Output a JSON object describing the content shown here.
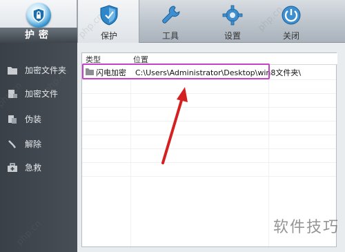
{
  "app": {
    "logo_label": "护密"
  },
  "toolbar": {
    "items": [
      {
        "label": "保护",
        "icon": "shield-icon",
        "active": true
      },
      {
        "label": "工具",
        "icon": "wrench-icon",
        "active": false
      },
      {
        "label": "设置",
        "icon": "gear-icon",
        "active": false
      },
      {
        "label": "关闭",
        "icon": "power-icon",
        "active": false
      }
    ]
  },
  "sidebar": {
    "items": [
      {
        "label": "加密文件夹",
        "icon": "folder-icon"
      },
      {
        "label": "加密文件",
        "icon": "file-lock-icon"
      },
      {
        "label": "伪装",
        "icon": "disguise-icon"
      },
      {
        "label": "解除",
        "icon": "unlock-icon"
      },
      {
        "label": "急救",
        "icon": "first-aid-icon"
      }
    ]
  },
  "table": {
    "headers": [
      "类型",
      "位置"
    ],
    "rows": [
      {
        "type": "闪电加密",
        "location": "C:\\Users\\Administrator\\Desktop\\win8文件夹\\"
      }
    ]
  },
  "watermark": {
    "text": "php.cn",
    "brand": "软件技巧"
  },
  "colors": {
    "highlight": "#c840c8",
    "arrow": "#d42020",
    "sidebar_bg": "#3a4047"
  }
}
